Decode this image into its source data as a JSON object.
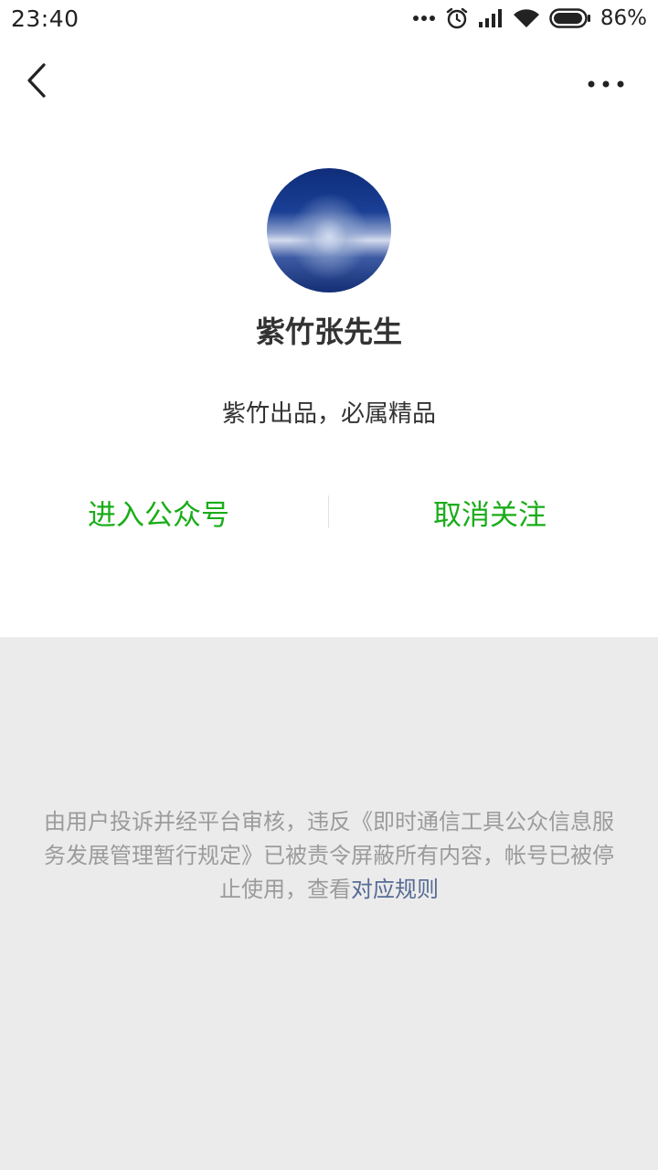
{
  "status_bar": {
    "time": "23:40",
    "battery_percent": "86%",
    "icons": [
      "more-dots-icon",
      "alarm-icon",
      "signal-icon",
      "wifi-icon",
      "battery-icon"
    ]
  },
  "nav": {
    "back_icon": "chevron-left-icon",
    "more_icon": "more-horizontal-icon"
  },
  "profile": {
    "name": "紫竹张先生",
    "description": "紫竹出品，必属精品"
  },
  "actions": {
    "enter_label": "进入公众号",
    "unfollow_label": "取消关注"
  },
  "notice": {
    "text": "由用户投诉并经平台审核，违反《即时通信工具公众信息服务发展管理暂行规定》已被责令屏蔽所有内容，帐号已被停止使用，查看",
    "link_text": "对应规则"
  },
  "colors": {
    "accent_green": "#1aad19",
    "link_blue": "#576b95",
    "notice_gray": "#9b9b9b",
    "section_bg": "#ebebeb"
  }
}
